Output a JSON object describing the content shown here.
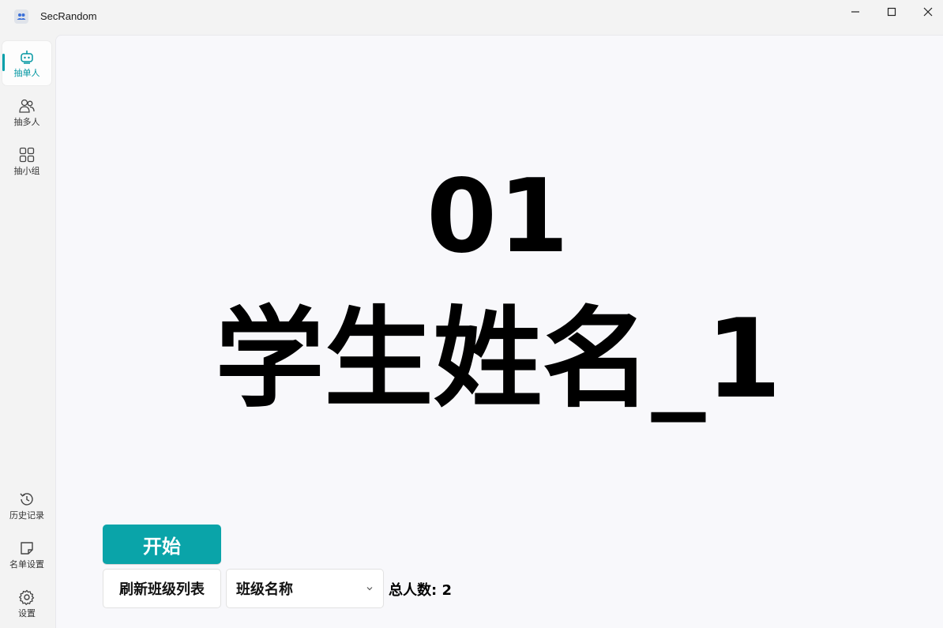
{
  "window": {
    "title": "SecRandom",
    "app_icon": "people-icon",
    "controls": [
      "minimize-icon",
      "maximize-icon",
      "close-icon"
    ]
  },
  "sidebar": {
    "accent": "#009faa",
    "top_items": [
      {
        "label": "抽单人",
        "icon": "robot-icon",
        "active": true
      },
      {
        "label": "抽多人",
        "icon": "people-icon",
        "active": false
      },
      {
        "label": "抽小组",
        "icon": "grid-icon",
        "active": false
      }
    ],
    "bottom_items": [
      {
        "label": "历史记录",
        "icon": "history-icon"
      },
      {
        "label": "名单设置",
        "icon": "note-icon"
      },
      {
        "label": "设置",
        "icon": "gear-icon"
      }
    ]
  },
  "main": {
    "result": {
      "student_id": "01",
      "student_name": "学生姓名_1"
    },
    "start_button": "开始",
    "start_button_color": "#0aa4a9",
    "refresh_button": "刷新班级列表",
    "class_select": {
      "selected": "班级名称"
    },
    "total_label": "总人数: 2"
  }
}
